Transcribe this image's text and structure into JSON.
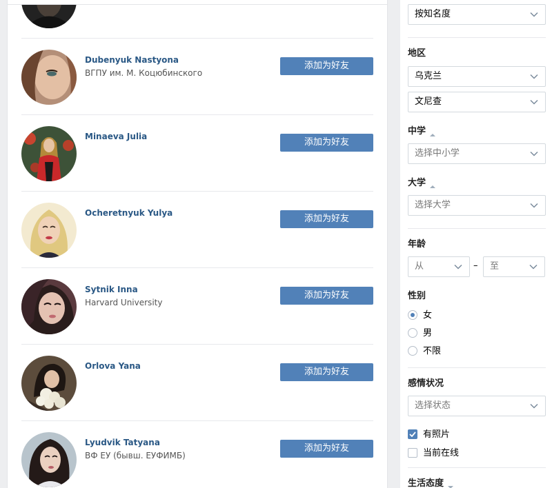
{
  "people": [
    {
      "name": "",
      "subtitle": "",
      "button": ""
    },
    {
      "name": "Dubenyuk Nastyona",
      "subtitle": "ВГПУ им. М. Коцюбинского",
      "button": "添加为好友"
    },
    {
      "name": "Minaeva Julia",
      "subtitle": "",
      "button": "添加为好友"
    },
    {
      "name": "Ocheretnyuk Yulya",
      "subtitle": "",
      "button": "添加为好友"
    },
    {
      "name": "Sytnik Inna",
      "subtitle": "Harvard University",
      "button": "添加为好友"
    },
    {
      "name": "Orlova Yana",
      "subtitle": "",
      "button": "添加为好友"
    },
    {
      "name": "Lyudvik Tatyana",
      "subtitle": "ВФ ЕУ (бывш. ЕУФИМБ)",
      "button": "添加为好友"
    }
  ],
  "filters": {
    "sort": {
      "value": "按知名度"
    },
    "region": {
      "title": "地区",
      "country": "乌克兰",
      "city": "文尼查"
    },
    "school": {
      "title": "中学",
      "placeholder": "选择中小学"
    },
    "university": {
      "title": "大学",
      "placeholder": "选择大学"
    },
    "age": {
      "title": "年龄",
      "from": "从",
      "separator": "–",
      "to": "至"
    },
    "gender": {
      "title": "性别",
      "options": [
        "女",
        "男",
        "不限"
      ],
      "selected": "女"
    },
    "relationship": {
      "title": "感情状况",
      "placeholder": "选择状态"
    },
    "with_photo": {
      "label": "有照片",
      "checked": true
    },
    "online_now": {
      "label": "当前在线",
      "checked": false
    },
    "life_views": {
      "title": "生活态度"
    }
  },
  "icons": {
    "dropdown": "chevron-down-icon",
    "expanded": "triangle-up-icon",
    "collapsed": "triangle-down-icon",
    "checkmark": "checkmark-icon"
  },
  "colors": {
    "link": "#2a5885",
    "button": "#5181b8",
    "background": "#edeef0"
  }
}
